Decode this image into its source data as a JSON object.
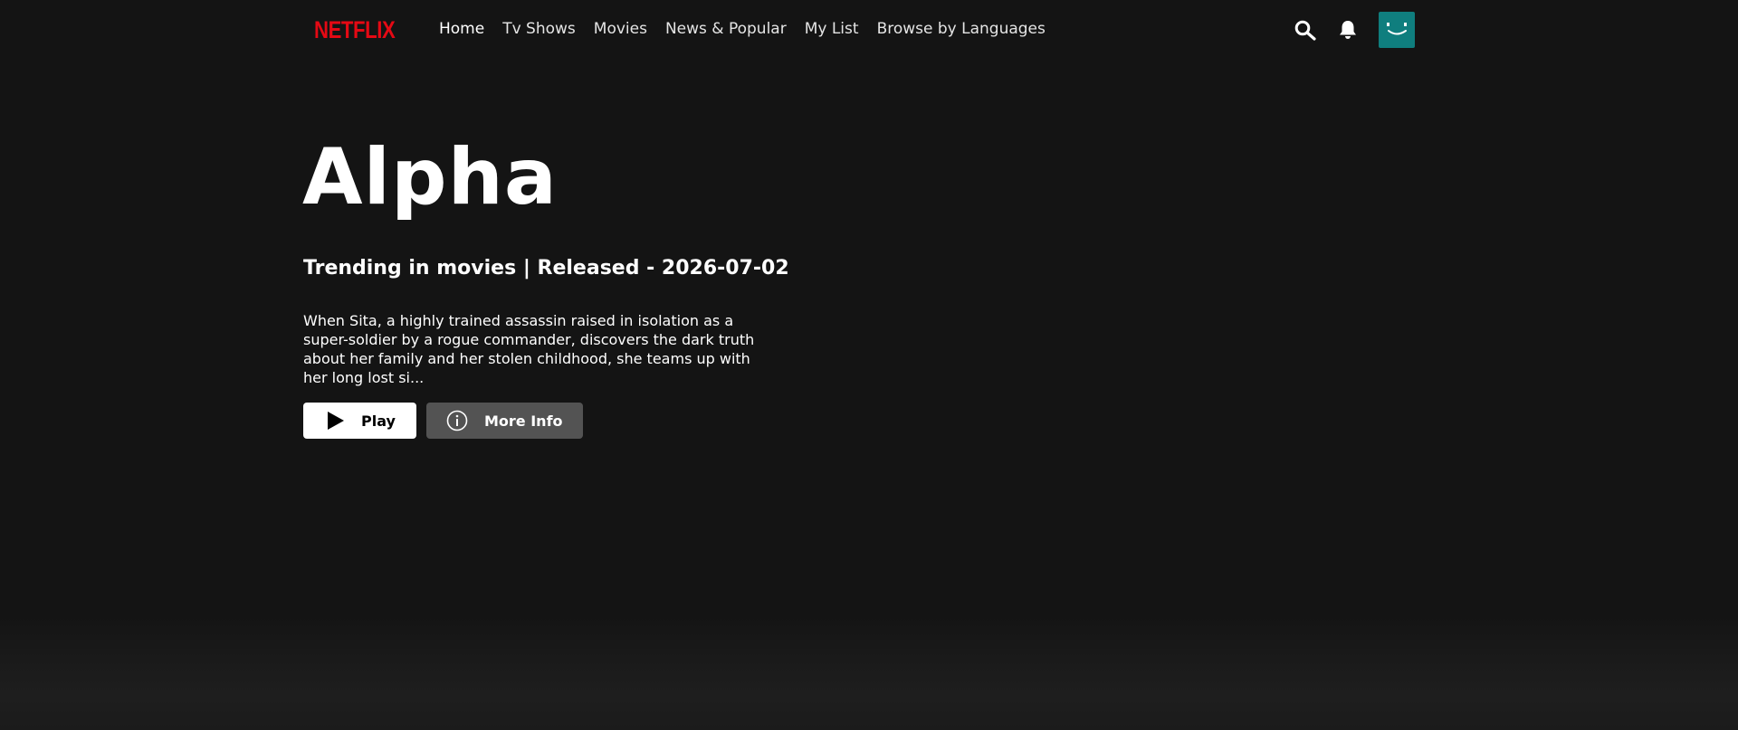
{
  "header": {
    "logo_text": "NETFLIX",
    "nav": [
      {
        "label": "Home",
        "active": true
      },
      {
        "label": "Tv Shows",
        "active": false
      },
      {
        "label": "Movies",
        "active": false
      },
      {
        "label": "News & Popular",
        "active": false
      },
      {
        "label": "My List",
        "active": false
      },
      {
        "label": "Browse by Languages",
        "active": false
      }
    ],
    "icons": {
      "search": "search-icon",
      "notifications": "bell-icon",
      "avatar": "smiley-avatar"
    }
  },
  "hero": {
    "title": "Alpha",
    "subtitle": "Trending in movies | Released - 2026-07-02",
    "description": "When Sita, a highly trained assassin raised in isolation as a super-soldier by a rogue commander, discovers the dark truth about her family and her stolen childhood, she teams up with her long lost si...",
    "play_label": "Play",
    "more_info_label": "More Info"
  },
  "colors": {
    "background": "#141414",
    "brand": "#e50914",
    "avatar": "#0f7e7e",
    "play_button": "#ffffff",
    "info_button": "#6d6d6e"
  }
}
